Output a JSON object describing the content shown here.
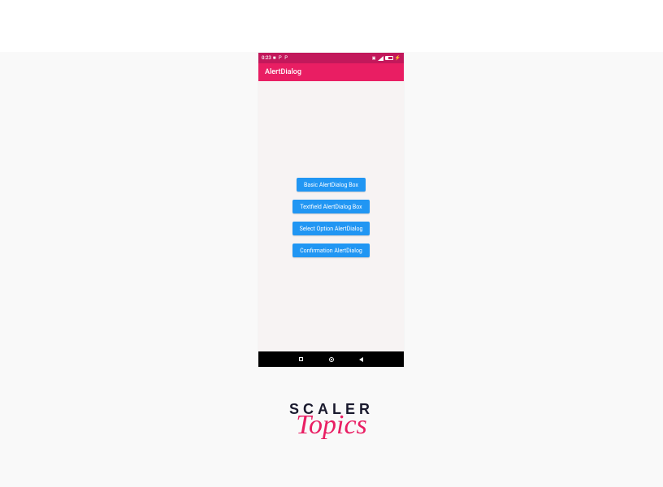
{
  "status": {
    "time": "0:23",
    "left_icons": "■ P P",
    "right_icons_label": "signal-battery"
  },
  "titlebar": {
    "title": "AlertDialog"
  },
  "buttons": [
    {
      "label": "Basic AlertDialog Box"
    },
    {
      "label": "Textfield AlertDialog Box"
    },
    {
      "label": "Select Option AlertDialog"
    },
    {
      "label": "Confirmation AlertDialog"
    }
  ],
  "logo": {
    "line1": "SCALER",
    "line2": "Topics"
  }
}
